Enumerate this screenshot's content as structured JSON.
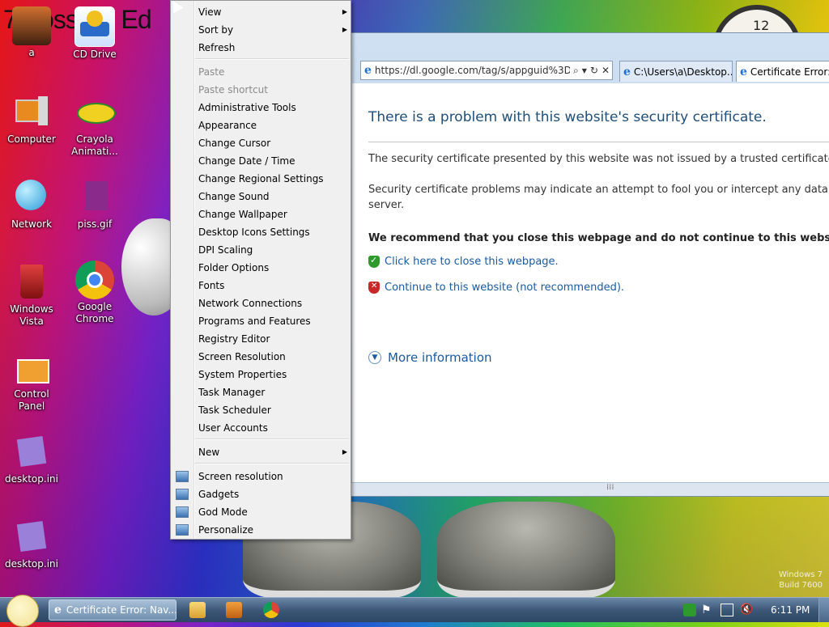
{
  "wallpaper": {
    "title_text": "7 Possible Ed",
    "clock_numeral": "12",
    "watermark_line1": "Windows 7",
    "watermark_line2": "Build 7600"
  },
  "desktop_icons": [
    {
      "label": "a"
    },
    {
      "label": "CD Drive"
    },
    {
      "label": "Computer"
    },
    {
      "label": "Crayola Animati..."
    },
    {
      "label": "Network"
    },
    {
      "label": "piss.gif"
    },
    {
      "label": "Windows Vista"
    },
    {
      "label": "Google Chrome"
    },
    {
      "label": "Control Panel"
    },
    {
      "label": "desktop.ini"
    },
    {
      "label": "desktop.ini"
    }
  ],
  "context_menu": {
    "items": [
      {
        "label": "View",
        "submenu": true
      },
      {
        "label": "Sort by",
        "submenu": true
      },
      {
        "label": "Refresh"
      },
      {
        "label": "Paste",
        "disabled": true
      },
      {
        "label": "Paste shortcut",
        "disabled": true
      },
      {
        "label": "Administrative Tools"
      },
      {
        "label": "Appearance"
      },
      {
        "label": "Change Cursor"
      },
      {
        "label": "Change Date / Time"
      },
      {
        "label": "Change Regional Settings"
      },
      {
        "label": "Change Sound"
      },
      {
        "label": "Change Wallpaper"
      },
      {
        "label": "Desktop Icons Settings"
      },
      {
        "label": "DPI Scaling"
      },
      {
        "label": "Folder Options"
      },
      {
        "label": "Fonts"
      },
      {
        "label": "Network Connections"
      },
      {
        "label": "Programs and Features"
      },
      {
        "label": "Registry Editor"
      },
      {
        "label": "Screen Resolution"
      },
      {
        "label": "System Properties"
      },
      {
        "label": "Task Manager"
      },
      {
        "label": "Task Scheduler"
      },
      {
        "label": "User Accounts"
      },
      {
        "label": "New",
        "submenu": true
      },
      {
        "label": "Screen resolution",
        "icon": "monitor-icon"
      },
      {
        "label": "Gadgets",
        "icon": "gadgets-icon"
      },
      {
        "label": "God Mode",
        "icon": "godmode-icon"
      },
      {
        "label": "Personalize",
        "icon": "personalize-icon"
      }
    ]
  },
  "browser": {
    "address_url": "https://dl.google.com/tag/s/appguid%3D",
    "tabs": [
      {
        "label": "C:\\Users\\a\\Desktop..."
      },
      {
        "label": "Certificate Error:..."
      }
    ],
    "page": {
      "heading": "There is a problem with this website's security certificate.",
      "para1": "The security certificate presented by this website was not issued by a trusted certificate autho",
      "para2_line1": "Security certificate problems may indicate an attempt to fool you or intercept any data you se",
      "para2_line2": "server.",
      "recommend": "We recommend that you close this webpage and do not continue to this website.",
      "close_link": "Click here to close this webpage.",
      "continue_link": "Continue to this website (not recommended).",
      "more_info": "More information"
    },
    "grip": "⁞⁞⁞"
  },
  "taskbar": {
    "active_task_label": "Certificate Error: Nav...",
    "time": "6:11 PM"
  },
  "colors": {
    "link": "#1a5aa0",
    "heading": "#1f4e79",
    "shield_ok": "#2e9a2e",
    "shield_bad": "#c82828"
  }
}
